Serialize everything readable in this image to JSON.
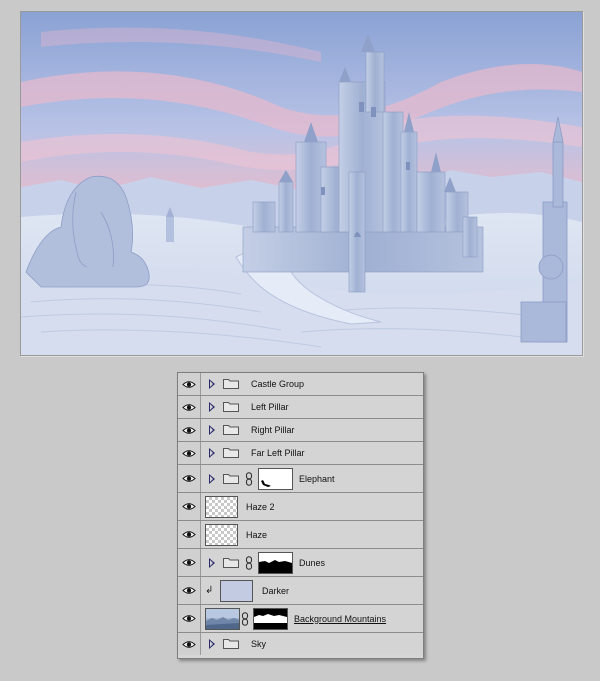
{
  "colors": {
    "page_bg": "#c9c9c9",
    "panel_bg": "#d6d6d6",
    "darker_swatch": "#c3cbe2",
    "sky_top": "#8aa4d6",
    "sky_pink": "#e8b8cc",
    "sand": "#dde5f2"
  },
  "layers": [
    {
      "name": "Castle Group",
      "kind": "group",
      "visible": true
    },
    {
      "name": "Left Pillar",
      "kind": "group",
      "visible": true
    },
    {
      "name": "Right Pillar",
      "kind": "group",
      "visible": true
    },
    {
      "name": "Far Left Pillar",
      "kind": "group",
      "visible": true
    },
    {
      "name": "Elephant",
      "kind": "group-with-mask",
      "visible": true
    },
    {
      "name": "Haze 2",
      "kind": "transparent-layer",
      "visible": true
    },
    {
      "name": "Haze",
      "kind": "transparent-layer",
      "visible": true
    },
    {
      "name": "Dunes",
      "kind": "group-with-mask",
      "visible": true
    },
    {
      "name": "Darker",
      "kind": "clipped-fill",
      "visible": true
    },
    {
      "name": "Background Mountains",
      "kind": "image-with-mask",
      "visible": true
    },
    {
      "name": "Sky",
      "kind": "group",
      "visible": true
    }
  ]
}
